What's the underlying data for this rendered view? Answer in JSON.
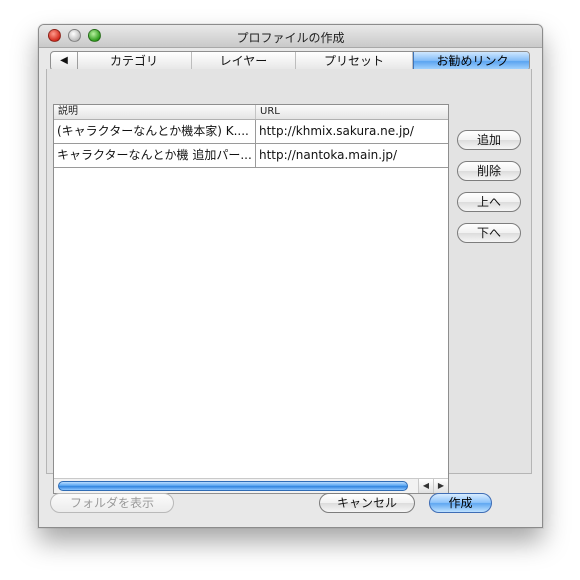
{
  "window": {
    "title": "プロファイルの作成"
  },
  "tabs": {
    "scroll_icon": "◀",
    "items": [
      {
        "label": "カテゴリ"
      },
      {
        "label": "レイヤー"
      },
      {
        "label": "プリセット"
      },
      {
        "label": "お勧めリンク",
        "selected": true
      }
    ]
  },
  "table": {
    "headers": [
      "説明",
      "URL"
    ],
    "rows": [
      {
        "description": "(キャラクターなんとか機本家) K....",
        "url": "http://khmix.sakura.ne.jp/"
      },
      {
        "description": "キャラクターなんとか機 追加パー...",
        "url": "http://nantoka.main.jp/"
      }
    ],
    "scroll_left_icon": "◀",
    "scroll_right_icon": "▶"
  },
  "side_buttons": {
    "add": "追加",
    "delete": "削除",
    "up": "上へ",
    "down": "下へ"
  },
  "bottom_buttons": {
    "show_folder": "フォルダを表示",
    "cancel": "キャンセル",
    "create": "作成"
  },
  "colors": {
    "accent_blue": "#5ea6f1",
    "window_bg": "#e8e8e8"
  }
}
